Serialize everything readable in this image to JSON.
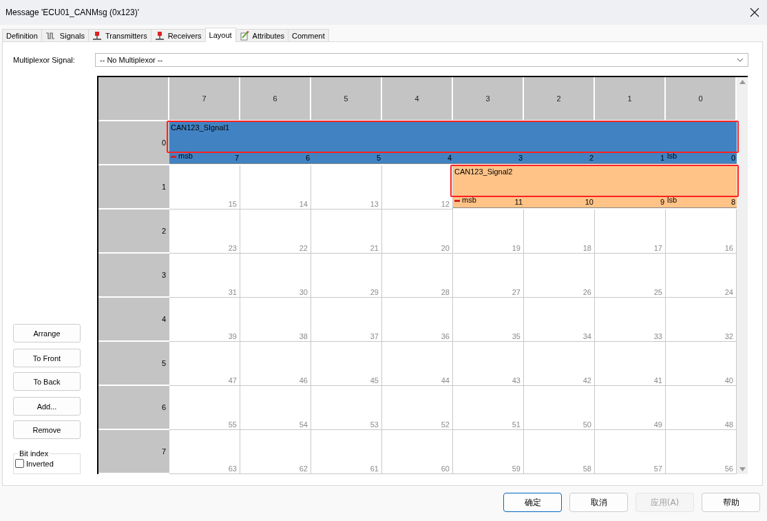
{
  "window": {
    "title": "Message 'ECU01_CANMsg (0x123)'"
  },
  "tabs": [
    {
      "label": "Definition",
      "kind": "plain",
      "selected": false
    },
    {
      "label": "Signals",
      "kind": "signals",
      "selected": false
    },
    {
      "label": "Transmitters",
      "kind": "node",
      "selected": false
    },
    {
      "label": "Receivers",
      "kind": "node",
      "selected": false
    },
    {
      "label": "Layout",
      "kind": "plain",
      "selected": true
    },
    {
      "label": "Attributes",
      "kind": "attributes",
      "selected": false
    },
    {
      "label": "Comment",
      "kind": "plain",
      "selected": false
    }
  ],
  "multiplexor": {
    "label": "Multiplexor Signal:",
    "value": "-- No Multiplexor --"
  },
  "side_buttons": [
    [
      "Arrange"
    ],
    [
      "To Front",
      "To Back"
    ],
    [
      "Add...",
      "Remove"
    ]
  ],
  "bit_index": {
    "title": "Bit index",
    "inverted": {
      "label": "Inverted",
      "checked": false
    }
  },
  "grid": {
    "columns": [
      "7",
      "6",
      "5",
      "4",
      "3",
      "2",
      "1",
      "0"
    ],
    "rows": [
      {
        "label": "0",
        "cells": [
          {
            "text": "7",
            "in_signal": true
          },
          {
            "text": "6",
            "in_signal": true
          },
          {
            "text": "5",
            "in_signal": true
          },
          {
            "text": "4",
            "in_signal": true
          },
          {
            "text": "3",
            "in_signal": true
          },
          {
            "text": "2",
            "in_signal": true
          },
          {
            "text": "1",
            "in_signal": true
          },
          {
            "text": "0",
            "in_signal": true
          }
        ],
        "signal": {
          "name": "CAN123_SIgnal1",
          "color": "#4182c3",
          "highlighted": true,
          "msb_label": "msb",
          "lsb_label": "lsb"
        }
      },
      {
        "label": "1",
        "cells": [
          {
            "text": "15",
            "in_signal": false
          },
          {
            "text": "14",
            "in_signal": false
          },
          {
            "text": "13",
            "in_signal": false
          },
          {
            "text": "12",
            "in_signal": false
          },
          {
            "text": "11",
            "in_signal": true
          },
          {
            "text": "10",
            "in_signal": true
          },
          {
            "text": "9",
            "in_signal": true
          },
          {
            "text": "8",
            "in_signal": true
          }
        ],
        "signal": {
          "name": "CAN123_Signal2",
          "color": "#ffc387",
          "highlighted": true,
          "msb_label": "msb",
          "lsb_label": "lsb"
        }
      },
      {
        "label": "2",
        "cells": [
          {
            "text": "23",
            "in_signal": false
          },
          {
            "text": "22",
            "in_signal": false
          },
          {
            "text": "21",
            "in_signal": false
          },
          {
            "text": "20",
            "in_signal": false
          },
          {
            "text": "19",
            "in_signal": false
          },
          {
            "text": "18",
            "in_signal": false
          },
          {
            "text": "17",
            "in_signal": false
          },
          {
            "text": "16",
            "in_signal": false
          }
        ]
      },
      {
        "label": "3",
        "cells": [
          {
            "text": "31",
            "in_signal": false
          },
          {
            "text": "30",
            "in_signal": false
          },
          {
            "text": "29",
            "in_signal": false
          },
          {
            "text": "28",
            "in_signal": false
          },
          {
            "text": "27",
            "in_signal": false
          },
          {
            "text": "26",
            "in_signal": false
          },
          {
            "text": "25",
            "in_signal": false
          },
          {
            "text": "24",
            "in_signal": false
          }
        ]
      },
      {
        "label": "4",
        "cells": [
          {
            "text": "39",
            "in_signal": false
          },
          {
            "text": "38",
            "in_signal": false
          },
          {
            "text": "37",
            "in_signal": false
          },
          {
            "text": "36",
            "in_signal": false
          },
          {
            "text": "35",
            "in_signal": false
          },
          {
            "text": "34",
            "in_signal": false
          },
          {
            "text": "33",
            "in_signal": false
          },
          {
            "text": "32",
            "in_signal": false
          }
        ]
      },
      {
        "label": "5",
        "cells": [
          {
            "text": "47",
            "in_signal": false
          },
          {
            "text": "46",
            "in_signal": false
          },
          {
            "text": "45",
            "in_signal": false
          },
          {
            "text": "44",
            "in_signal": false
          },
          {
            "text": "43",
            "in_signal": false
          },
          {
            "text": "42",
            "in_signal": false
          },
          {
            "text": "41",
            "in_signal": false
          },
          {
            "text": "40",
            "in_signal": false
          }
        ]
      },
      {
        "label": "6",
        "cells": [
          {
            "text": "55",
            "in_signal": false
          },
          {
            "text": "54",
            "in_signal": false
          },
          {
            "text": "53",
            "in_signal": false
          },
          {
            "text": "52",
            "in_signal": false
          },
          {
            "text": "51",
            "in_signal": false
          },
          {
            "text": "50",
            "in_signal": false
          },
          {
            "text": "49",
            "in_signal": false
          },
          {
            "text": "48",
            "in_signal": false
          }
        ]
      },
      {
        "label": "7",
        "cells": [
          {
            "text": "63",
            "in_signal": false
          },
          {
            "text": "62",
            "in_signal": false
          },
          {
            "text": "61",
            "in_signal": false
          },
          {
            "text": "60",
            "in_signal": false
          },
          {
            "text": "59",
            "in_signal": false
          },
          {
            "text": "58",
            "in_signal": false
          },
          {
            "text": "57",
            "in_signal": false
          },
          {
            "text": "56",
            "in_signal": false
          }
        ]
      }
    ]
  },
  "buttons": [
    {
      "label": "确定",
      "kind": "default",
      "disabled": false
    },
    {
      "label": "取消",
      "kind": "normal",
      "disabled": false
    },
    {
      "label": "应用(A)",
      "kind": "normal",
      "disabled": true
    },
    {
      "label": "帮助",
      "kind": "normal",
      "disabled": false
    }
  ]
}
